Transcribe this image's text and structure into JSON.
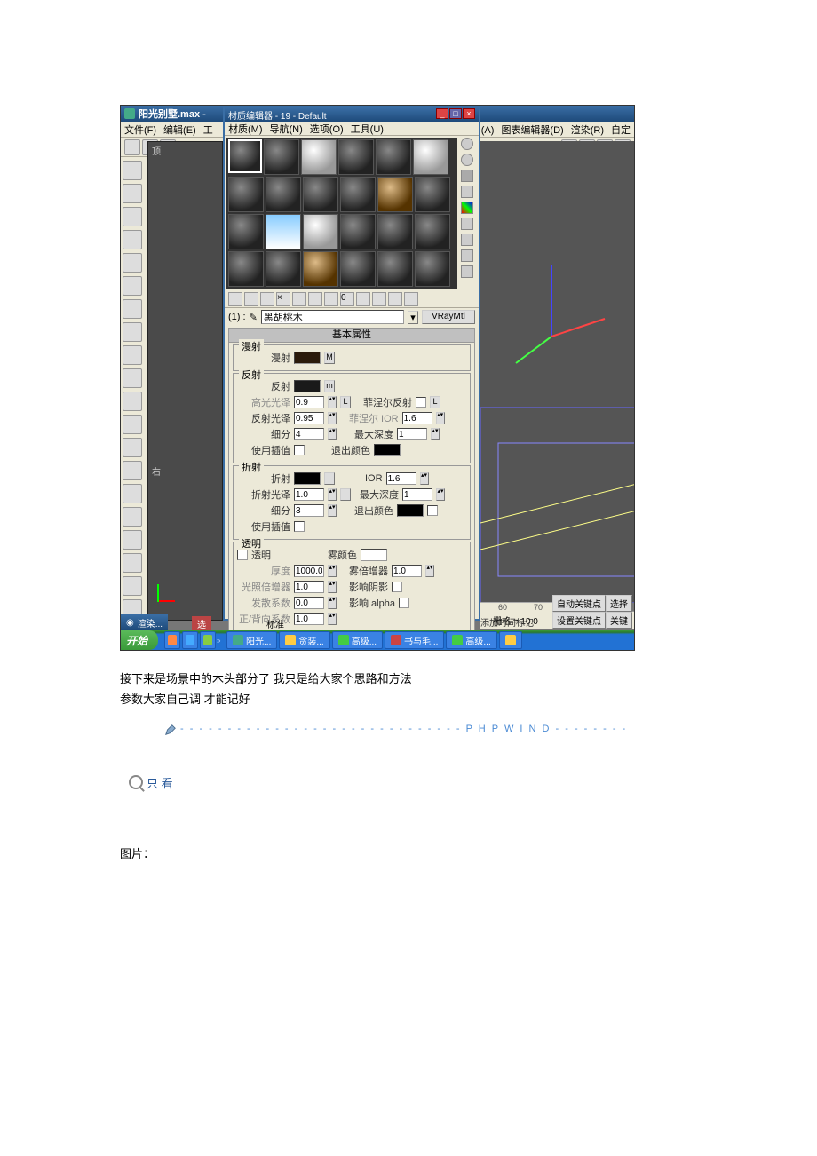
{
  "main_title": "阳光别墅.max -",
  "main_menu": [
    "文件(F)",
    "编辑(E)",
    "工"
  ],
  "right_menu": [
    "动画(A)",
    "图表编辑器(D)",
    "渲染(R)",
    "自定"
  ],
  "mat_editor": {
    "title": "材质编辑器 - 19 - Default",
    "menu": [
      "材质(M)",
      "导航(N)",
      "选项(O)",
      "工具(U)"
    ],
    "slot_label": "(1) :",
    "material_name": "黑胡桃木",
    "material_type": "VRayMtl",
    "rollout_basic": "基本属性",
    "groups": {
      "diffuse": "漫射",
      "diffuse_label": "漫射",
      "reflect": "反射",
      "reflect_label": "反射",
      "hilight_gloss": "高光光泽",
      "hilight_val": "0.9",
      "reflect_gloss": "反射光泽",
      "reflect_gloss_val": "0.95",
      "subdiv": "细分",
      "subdiv_val": "4",
      "use_interp": "使用插值",
      "fresnel": "菲涅尔反射",
      "fresnel_ior": "菲涅尔 IOR",
      "fresnel_ior_val": "1.6",
      "max_depth": "最大深度",
      "max_depth_val": "1",
      "exit_color": "退出颜色",
      "refract": "折射",
      "refract_label": "折射",
      "refract_gloss": "折射光泽",
      "refract_gloss_val": "1.0",
      "ior": "IOR",
      "ior_val": "1.6",
      "refract_subdiv": "细分",
      "refract_subdiv_val": "3",
      "refract_max_depth": "最大深度",
      "refract_max_depth_val": "1",
      "refract_exit": "退出颜色",
      "transp": "透明",
      "transp_chk": "透明",
      "thickness": "厚度",
      "thickness_val": "1000.0",
      "light_mult": "光照倍增器",
      "light_mult_val": "1.0",
      "scatter": "发散系数",
      "scatter_val": "0.0",
      "fwd_back": "正/背向系数",
      "fwd_back_val": "1.0",
      "fog_color": "雾颜色",
      "fog_mult": "雾倍增器",
      "fog_mult_val": "1.0",
      "affect_shadow": "影响阴影",
      "affect_alpha": "影响 alpha"
    }
  },
  "timeline": {
    "grid": "栅格 = 10.0",
    "add_marker": "添加时间标记",
    "auto_key": "自动关键点",
    "set_key": "设置关键点",
    "sel": "选择",
    "key": "关键"
  },
  "render_tag": "渲染...",
  "status_std": "标准",
  "taskbar": {
    "start": "开始",
    "items": [
      "阳光...",
      "贪装...",
      "高级...",
      "书与毛...",
      "高级...",
      ""
    ]
  },
  "body_line1": "接下来是场景中的木头部分了 我只是给大家个思路和方法",
  "body_line2": "参数大家自己调 才能记好",
  "divider_text": "- - - - - - - - - - - - - - - - - - - - - - - - - - - - - - P H P W I N D - - - - - - - -",
  "only_view": "只 看",
  "pic_label": "图片："
}
